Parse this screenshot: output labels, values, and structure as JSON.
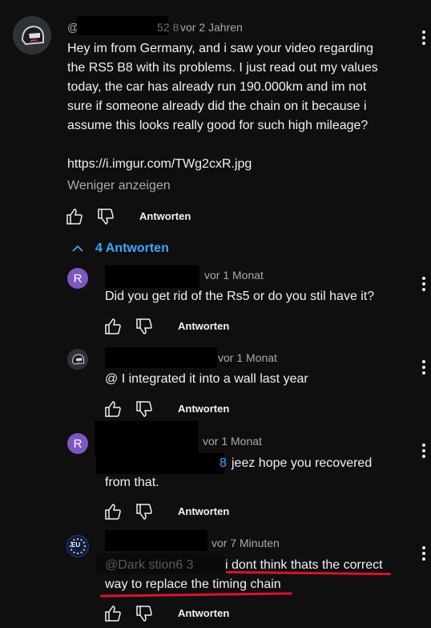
{
  "main_comment": {
    "handle": "@",
    "handle_suffix": "52 8",
    "time": "vor 2 Jahren",
    "text_lines": [
      "Hey im from Germany, and i saw your video regarding",
      "the RS5 B8 with its problems. I just read out my values",
      "today, the car has already run 190.000km and im not",
      "sure if someone already did the chain on it because i",
      "assume this looks really good for such high mileage?"
    ],
    "link": "https://i.imgur.com/TWg2cxR.jpg",
    "show_less": "Weniger anzeigen",
    "reply_label": "Antworten"
  },
  "replies_toggle": "4 Antworten",
  "replies": [
    {
      "avatar_letter": "R",
      "time": "vor 1 Monat",
      "text_lines": [
        "Did you get rid of the Rs5 or do you stil have it?"
      ],
      "reply_label": "Antworten"
    },
    {
      "avatar_letter": "",
      "time": "vor 1 Monat",
      "text_lines": [
        "@ I integrated it into a wall last year"
      ],
      "reply_label": "Antworten"
    },
    {
      "avatar_letter": "R",
      "time": "vor 1 Monat",
      "mention_tail": "8",
      "text_lines": [
        "jeez hope you recovered",
        "from that."
      ],
      "reply_label": "Antworten"
    },
    {
      "avatar_letter": "EU",
      "time": "vor 7 Minuten",
      "mention": "@Dark   stion6   3",
      "text_lines": [
        "i dont think thats the correct",
        "way to replace the timing chain"
      ],
      "reply_label": "Antworten"
    }
  ],
  "colors": {
    "background": "#0f0f0f",
    "text": "#f1f1f1",
    "secondary": "#aaaaaa",
    "accent": "#3ea6ff",
    "annotation": "#e0102a",
    "avatar_purple": "#7e57c2"
  }
}
